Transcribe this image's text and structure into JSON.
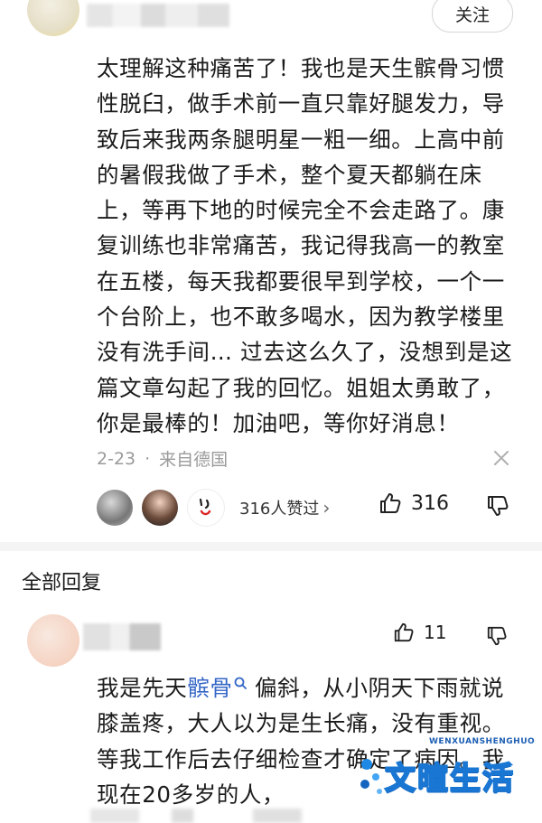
{
  "header": {
    "follow_label": "关注"
  },
  "comment": {
    "text": "太理解这种痛苦了！我也是天生髌骨习惯性脱臼，做手术前一直只靠好腿发力，导致后来我两条腿明星一粗一细。上高中前的暑假我做了手术，整个夏天都躺在床上，等再下地的时候完全不会走路了。康复训练也非常痛苦，我记得我高一的教室在五楼，每天我都要很早到学校，一个一个台阶上，也不敢多喝水，因为教学楼里没有洗手间… 过去这么久了，没想到是这篇文章勾起了我的回忆。姐姐太勇敢了，你是最棒的！加油吧，等你好消息！",
    "date": "2-23",
    "separator": "·",
    "location": "来自德国",
    "liked_by": "316人赞过",
    "liked_by_chevron": "›",
    "like_count": "316"
  },
  "replies_section": {
    "title": "全部回复"
  },
  "reply": {
    "text_before": "我是先天",
    "keyword": "髌骨",
    "text_after": " 偏斜，从小阴天下雨就说膝盖疼，大人以为是生长痛，没有重视。等我工作后去仔细检查才确定了病因。我现在20多岁的人，",
    "like_count": "11"
  },
  "watermark": {
    "small": "WENXUANSHENGHUO",
    "big": "文暄生活"
  },
  "colors": {
    "keyword": "#3466c7",
    "meta": "#9a9a9a",
    "watermark": "#1976d2"
  }
}
